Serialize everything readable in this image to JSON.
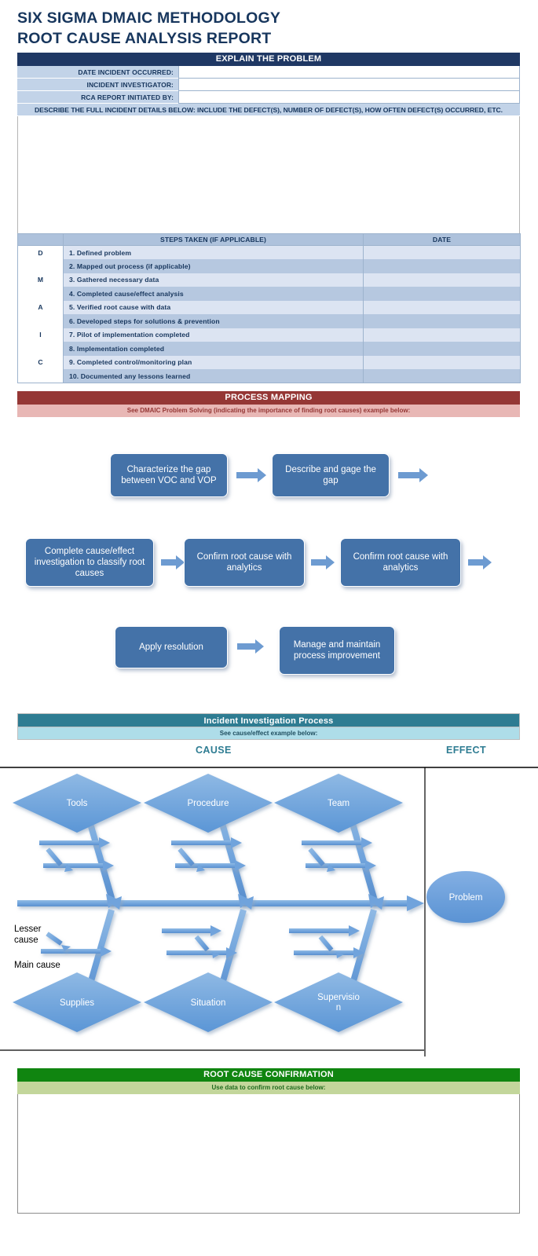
{
  "document": {
    "title_line_1": "SIX SIGMA DMAIC METHODOLOGY",
    "title_line_2": "ROOT CAUSE ANALYSIS REPORT"
  },
  "explain_problem": {
    "header": "EXPLAIN THE PROBLEM",
    "fields": [
      {
        "label": "DATE INCIDENT OCCURRED:",
        "value": ""
      },
      {
        "label": "INCIDENT INVESTIGATOR:",
        "value": ""
      },
      {
        "label": "RCA REPORT INITIATED BY:",
        "value": ""
      }
    ],
    "describe_header": "DESCRIBE THE FULL INCIDENT DETAILS BELOW: INCLUDE THE DEFECT(S), NUMBER OF DEFECT(S), HOW OFTEN DEFECT(S) OCCURRED, ETC.",
    "describe_value": ""
  },
  "steps_table": {
    "columns": [
      "",
      "STEPS TAKEN (IF APPLICABLE)",
      "DATE"
    ],
    "rows": [
      {
        "letter": "D",
        "step": "1. Defined problem",
        "date": ""
      },
      {
        "letter": "",
        "step": "2. Mapped out process (if applicable)",
        "date": ""
      },
      {
        "letter": "M",
        "step": "3. Gathered necessary data",
        "date": ""
      },
      {
        "letter": "",
        "step": "4. Completed cause/effect analysis",
        "date": ""
      },
      {
        "letter": "A",
        "step": "5. Verified root cause with data",
        "date": ""
      },
      {
        "letter": "",
        "step": "6. Developed steps for solutions & prevention",
        "date": ""
      },
      {
        "letter": "I",
        "step": "7. Pilot of implementation completed",
        "date": ""
      },
      {
        "letter": "",
        "step": "8. Implementation completed",
        "date": ""
      },
      {
        "letter": "C",
        "step": "9. Completed control/monitoring plan",
        "date": ""
      },
      {
        "letter": "",
        "step": "10. Documented any lessons learned",
        "date": ""
      }
    ]
  },
  "process_mapping": {
    "header": "PROCESS MAPPING",
    "subheader": "See DMAIC Problem Solving (indicating the importance of finding root causes) example below:",
    "flow_boxes": [
      "Characterize the gap between VOC and VOP",
      "Describe and gage the gap",
      "Complete cause/effect investigation to classify root causes",
      "Confirm root cause with analytics",
      "Confirm root cause with analytics",
      "Apply resolution",
      "Manage and maintain process improvement"
    ]
  },
  "incident_investigation": {
    "header": "Incident Investigation Process",
    "subheader": "See cause/effect example below:",
    "cause_label": "CAUSE",
    "effect_label": "EFFECT",
    "fishbone": {
      "top_categories": [
        "Tools",
        "Procedure",
        "Team"
      ],
      "bottom_categories": [
        "Supplies",
        "Situation",
        "Supervisio n"
      ],
      "effect_node": "Problem",
      "annotations": [
        "Lesser cause",
        "Main cause"
      ]
    }
  },
  "root_cause_confirmation": {
    "header": "ROOT CAUSE CONFIRMATION",
    "subheader": "Use data to confirm root cause below:",
    "value": ""
  },
  "colors": {
    "navy": "#1F3864",
    "light_blue": "#C2D3E8",
    "maroon": "#953735",
    "maroon_light": "#E8B7B5",
    "teal": "#2E7C92",
    "teal_light": "#AEDDE9",
    "green": "#108510",
    "green_light": "#C3D69B",
    "flow_blue": "#4472A8",
    "arrow_blue": "#6D9BD1",
    "fishbone_blue": "#6FA3DC"
  }
}
